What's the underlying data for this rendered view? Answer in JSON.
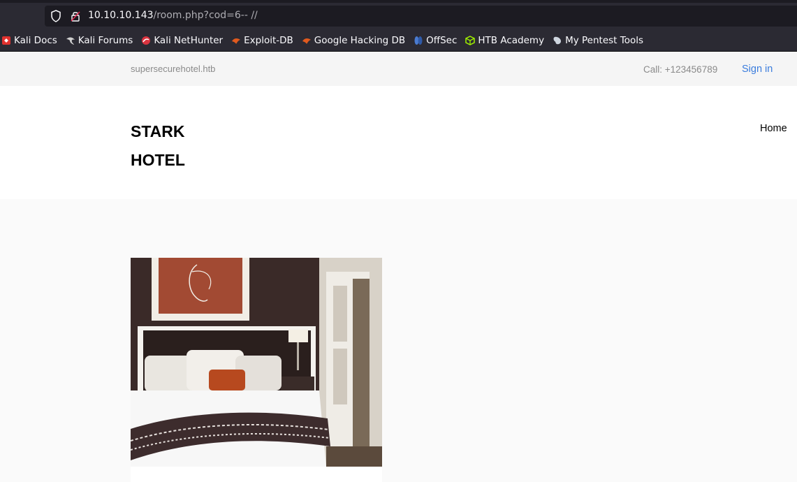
{
  "browser": {
    "url_host": "10.10.10.143",
    "url_path": "/room.php?cod=6-- //",
    "bookmarks": [
      {
        "label": "Kali Docs",
        "icon": "kali-docs-icon",
        "color": "#e0312e"
      },
      {
        "label": "Kali Forums",
        "icon": "kali-dragon-icon",
        "color": "#cfcfcf"
      },
      {
        "label": "Kali NetHunter",
        "icon": "nethunter-icon",
        "color": "#d9333f"
      },
      {
        "label": "Exploit-DB",
        "icon": "exploit-db-icon",
        "color": "#e05a1e"
      },
      {
        "label": "Google Hacking DB",
        "icon": "ghdb-icon",
        "color": "#e05a1e"
      },
      {
        "label": "OffSec",
        "icon": "offsec-icon",
        "color": "#4a7bd0"
      },
      {
        "label": "HTB Academy",
        "icon": "htb-cube-icon",
        "color": "#9fef00"
      },
      {
        "label": "My Pentest Tools",
        "icon": "pentest-tools-icon",
        "color": "#cfd6e0"
      }
    ]
  },
  "page": {
    "site_domain": "supersecurehotel.htb",
    "call_text": "Call: +123456789",
    "signin_label": "Sign in",
    "brand_line1": "STARK",
    "brand_line2": "HOTEL",
    "nav_home": "Home"
  }
}
